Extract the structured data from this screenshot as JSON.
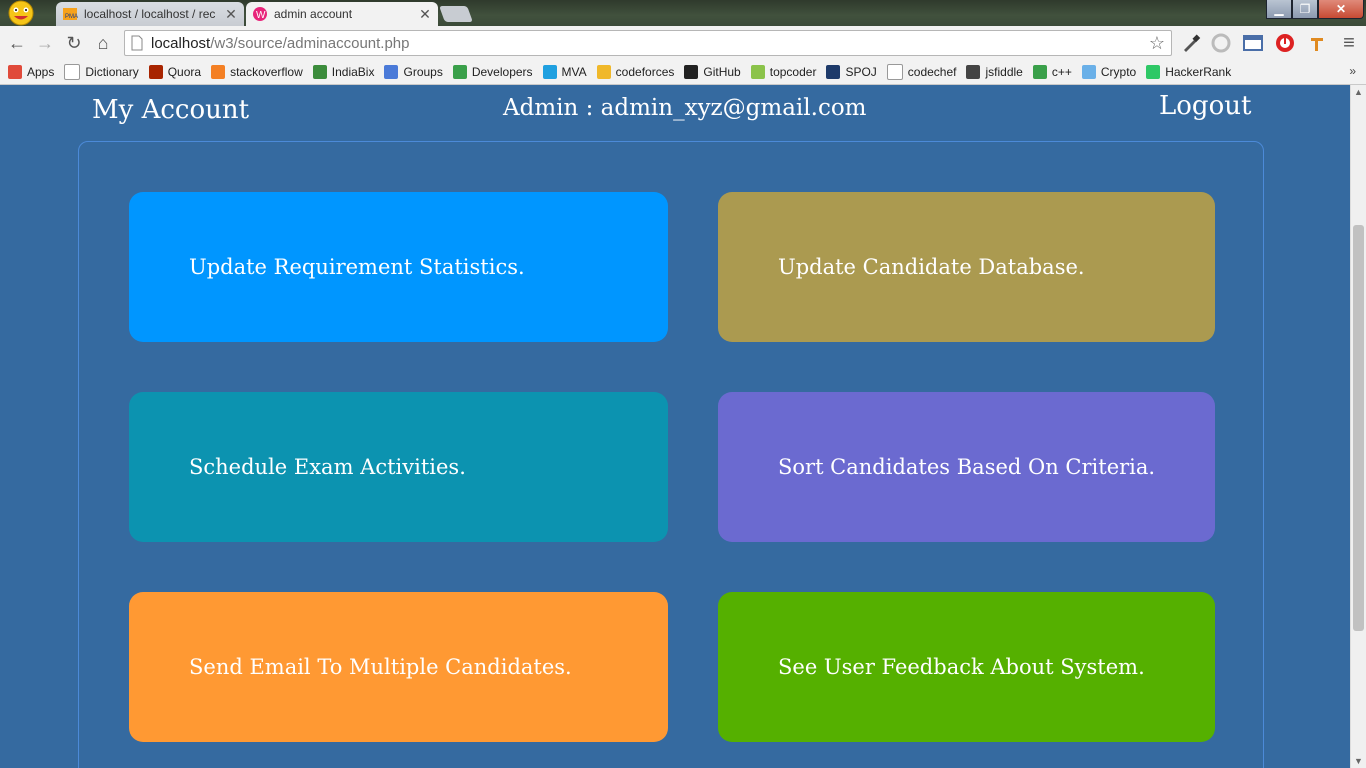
{
  "browser": {
    "tabs": [
      {
        "title": "localhost / localhost / rec",
        "active": false
      },
      {
        "title": "admin account",
        "active": true
      }
    ],
    "address": {
      "host": "localhost",
      "path": "/w3/source/adminaccount.php"
    },
    "bookmarks": [
      {
        "label": "Apps",
        "icon": "apps-grid-icon",
        "color": "#e04a3a"
      },
      {
        "label": "Dictionary",
        "icon": "page-icon",
        "color": "#ffffff"
      },
      {
        "label": "Quora",
        "icon": "quora-icon",
        "color": "#a82400"
      },
      {
        "label": "stackoverflow",
        "icon": "stackoverflow-icon",
        "color": "#f48024"
      },
      {
        "label": "IndiaBix",
        "icon": "indiabix-icon",
        "color": "#3c8c3c"
      },
      {
        "label": "Groups",
        "icon": "groups-icon",
        "color": "#4a7ad8"
      },
      {
        "label": "Developers",
        "icon": "developers-icon",
        "color": "#3aa04a"
      },
      {
        "label": "MVA",
        "icon": "mva-icon",
        "color": "#1fa0e0"
      },
      {
        "label": "codeforces",
        "icon": "codeforces-icon",
        "color": "#f0b82a"
      },
      {
        "label": "GitHub",
        "icon": "github-icon",
        "color": "#222222"
      },
      {
        "label": "topcoder",
        "icon": "topcoder-icon",
        "color": "#8bc34a"
      },
      {
        "label": "SPOJ",
        "icon": "spoj-icon",
        "color": "#1e3a6a"
      },
      {
        "label": "codechef",
        "icon": "page-icon",
        "color": "#ffffff"
      },
      {
        "label": "jsfiddle",
        "icon": "jsfiddle-icon",
        "color": "#444444"
      },
      {
        "label": "c++",
        "icon": "developers-icon",
        "color": "#3aa04a"
      },
      {
        "label": "Crypto",
        "icon": "crypto-icon",
        "color": "#6ab0e8"
      },
      {
        "label": "HackerRank",
        "icon": "hackerrank-icon",
        "color": "#2ec866"
      }
    ],
    "more": "»"
  },
  "page": {
    "title": "My Account",
    "admin_label": "Admin : admin_xyz@gmail.com",
    "logout": "Logout",
    "cards": [
      {
        "label": "Update Requirement Statistics.",
        "color": "#0096ff"
      },
      {
        "label": "Update Candidate Database.",
        "color": "#ab9a50"
      },
      {
        "label": "Schedule Exam Activities.",
        "color": "#0c93b0"
      },
      {
        "label": "Sort Candidates Based On Criteria.",
        "color": "#6b6ad0"
      },
      {
        "label": "Send Email To Multiple Candidates.",
        "color": "#ff9933"
      },
      {
        "label": "See User Feedback About System.",
        "color": "#55b000"
      }
    ],
    "background": "#356aa0"
  }
}
